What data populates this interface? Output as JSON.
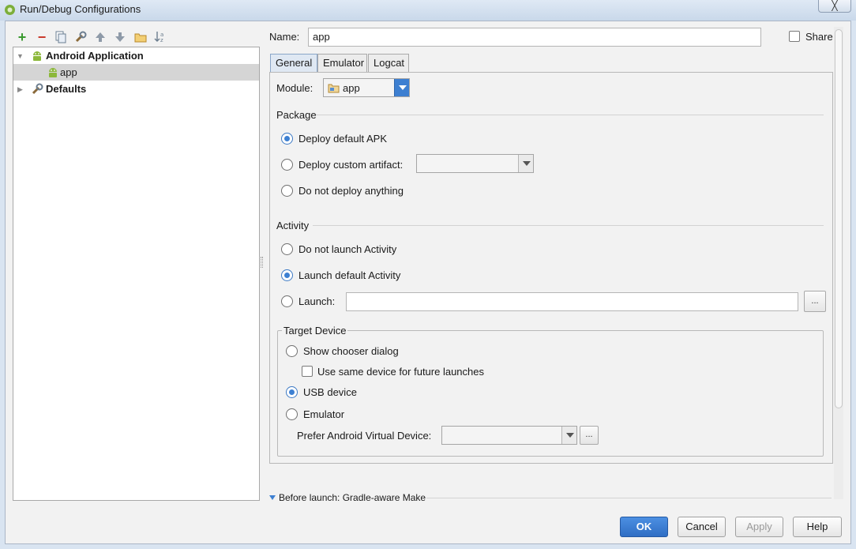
{
  "window": {
    "title": "Run/Debug Configurations",
    "close_glyph": "╳"
  },
  "tree": {
    "items": [
      {
        "label": "Android Application",
        "expanded": true
      },
      {
        "label": "app",
        "selected": true
      },
      {
        "label": "Defaults",
        "expanded": false
      }
    ]
  },
  "name_field": {
    "label": "Name:",
    "value": "app"
  },
  "share": {
    "label": "Share",
    "checked": false
  },
  "tabs": [
    {
      "label": "General",
      "active": true
    },
    {
      "label": "Emulator",
      "active": false
    },
    {
      "label": "Logcat",
      "active": false
    }
  ],
  "module": {
    "label": "Module:",
    "value": "app"
  },
  "package": {
    "title": "Package",
    "options": [
      {
        "label": "Deploy default APK",
        "selected": true
      },
      {
        "label": "Deploy custom artifact:",
        "selected": false
      },
      {
        "label": "Do not deploy anything",
        "selected": false
      }
    ]
  },
  "activity": {
    "title": "Activity",
    "options": [
      {
        "label": "Do not launch Activity",
        "selected": false
      },
      {
        "label": "Launch default Activity",
        "selected": true
      },
      {
        "label": "Launch:",
        "selected": false
      }
    ],
    "launch_value": "",
    "browse_label": "..."
  },
  "target_device": {
    "title": "Target Device",
    "show_chooser": {
      "label": "Show chooser dialog",
      "selected": false
    },
    "same_device": {
      "label": "Use same device for future launches",
      "checked": false
    },
    "usb": {
      "label": "USB device",
      "selected": true
    },
    "emulator": {
      "label": "Emulator",
      "selected": false
    },
    "prefer_avd": {
      "label": "Prefer Android Virtual Device:",
      "value": ""
    },
    "browse_label": "..."
  },
  "before_launch": {
    "label": "Before launch: Gradle-aware Make"
  },
  "buttons": {
    "ok": "OK",
    "cancel": "Cancel",
    "apply": "Apply",
    "help": "Help"
  },
  "colors": {
    "accent": "#3d80d2",
    "android_green": "#8cb83a"
  }
}
